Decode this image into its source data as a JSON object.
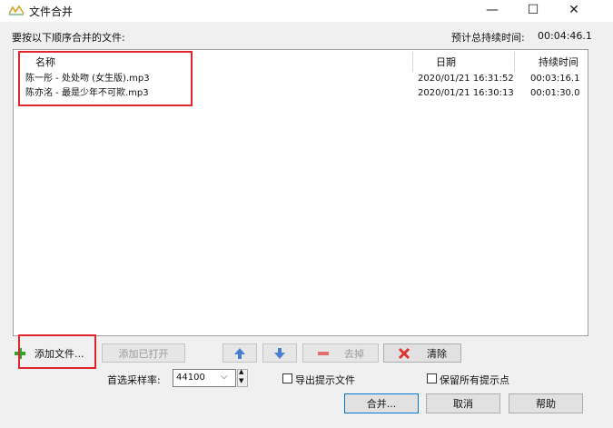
{
  "window": {
    "title": "文件合并",
    "minimize": "—",
    "maximize": "☐",
    "close": "✕"
  },
  "header": {
    "instruction": "要按以下顺序合并的文件:",
    "total_label": "预计总持续时间:",
    "total_value": "00:04:46.1"
  },
  "table": {
    "columns": [
      "名称",
      "日期",
      "持续时间"
    ],
    "rows": [
      {
        "name": "陈一彤 - 处处吻 (女生版).mp3",
        "date": "2020/01/21 16:31:52",
        "duration": "00:03:16.1"
      },
      {
        "name": "陈亦洺 - 最是少年不可欺.mp3",
        "date": "2020/01/21 16:30:13",
        "duration": "00:01:30.0"
      }
    ]
  },
  "toolbar": {
    "add_file": "添加文件...",
    "add_opened": "添加已打开",
    "remove": "去掉",
    "clear": "清除"
  },
  "options": {
    "sample_rate_label": "首选采样率:",
    "sample_rate_value": "44100",
    "export_cue": "导出提示文件",
    "keep_cues": "保留所有提示点"
  },
  "actions": {
    "merge": "合并...",
    "cancel": "取消",
    "help": "帮助"
  },
  "colors": {
    "highlight_box": "#e0262a",
    "arrow_blue": "#4a7fd0",
    "add_green": "#2fa52f",
    "remove_red": "#d33"
  }
}
